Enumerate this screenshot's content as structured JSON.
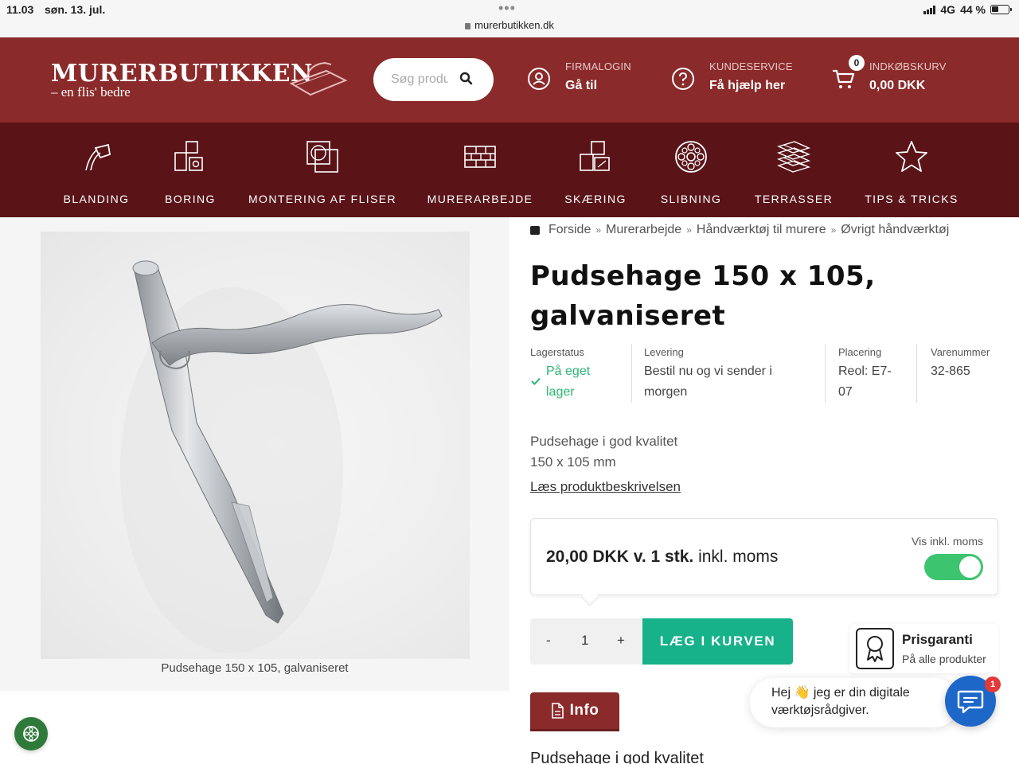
{
  "statusbar": {
    "time": "11.03",
    "date": "søn. 13. jul.",
    "url": "murerbutikken.dk",
    "network": "4G",
    "battery": "44 %"
  },
  "header": {
    "logo_name": "MURERBUTIKKEN",
    "logo_tagline": "– en flis' bedre",
    "search_placeholder": "Søg produkter",
    "firmalogin_small": "FIRMALOGIN",
    "firmalogin_big": "Gå til",
    "service_small": "KUNDESERVICE",
    "service_big": "Få hjælp her",
    "cart_small": "INDKØBSKURV",
    "cart_big": "0,00 DKK",
    "cart_count": "0"
  },
  "categories": [
    {
      "label": "BLANDING",
      "icon": "mixing-bucket-icon"
    },
    {
      "label": "BORING",
      "icon": "drill-squares-icon"
    },
    {
      "label": "MONTERING AF FLISER",
      "icon": "tile-mounting-icon"
    },
    {
      "label": "MURERARBEJDE",
      "icon": "brick-wall-icon"
    },
    {
      "label": "SKÆRING",
      "icon": "tile-cutting-icon"
    },
    {
      "label": "SLIBNING",
      "icon": "grinding-disc-icon"
    },
    {
      "label": "TERRASSER",
      "icon": "terrace-layers-icon"
    },
    {
      "label": "TIPS & TRICKS",
      "icon": "star-icon"
    }
  ],
  "product": {
    "image_caption": "Pudsehage 150 x 105, galvaniseret",
    "breadcrumbs": [
      "Forside",
      "Murerarbejde",
      "Håndværktøj til murere",
      "Øvrigt håndværktøj"
    ],
    "title_line1": "Pudsehage 150 x 105,",
    "title_line2": "galvaniseret",
    "meta": {
      "stock_label": "Lagerstatus",
      "stock_line1": "På eget",
      "stock_line2": "lager",
      "delivery_label": "Levering",
      "delivery_line1": "Bestil nu og vi sender i",
      "delivery_line2": "morgen",
      "placement_label": "Placering",
      "placement_line1": "Reol: E7-",
      "placement_line2": "07",
      "sku_label": "Varenummer",
      "sku": "32-865"
    },
    "desc_line1": "Pudsehage i god kvalitet",
    "desc_line2": "150 x 105 mm",
    "read_more": "Læs produktbeskrivelsen",
    "price_main": "20,00 DKK v. 1 stk.",
    "price_suffix": "inkl. moms",
    "vat_toggle_label": "Vis inkl. moms",
    "vat_toggle_on": true,
    "qty_minus": "-",
    "qty_value": "1",
    "qty_plus": "+",
    "add_to_cart": "LÆG I KURVEN",
    "guarantee_title": "Prisgaranti",
    "guarantee_sub": "På alle produkter",
    "info_tab": "Info",
    "bottom_heading": "Pudsehage i god kvalitet"
  },
  "chat": {
    "line1": "Hej 👋 jeg er din digitale",
    "line2": "værktøjsrådgiver.",
    "badge": "1"
  },
  "colors": {
    "header_bg": "#8b2a2a",
    "nav_bg": "#5a1418",
    "accent_green": "#17b18a",
    "stock_green": "#2bb673",
    "chat_blue": "#1d67c8"
  }
}
